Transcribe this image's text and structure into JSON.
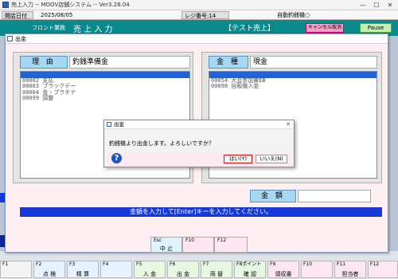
{
  "window": {
    "title": "売上入力 -- MOOV店舗システム -- Ver3.28.04",
    "controls": {
      "minimize": "—",
      "maximize": "☐",
      "close": "✕"
    }
  },
  "infobar": {
    "date_label": "開店日付",
    "date_value": "2025/08/05",
    "register_label": "レジ番号:14",
    "auto_label": "自動釣銭機○"
  },
  "header": {
    "front": "フロント業務",
    "module": "売 上 入 力",
    "test_label": "【テスト売上】",
    "cancel_button": "キャンセル取消",
    "pause_button": "Pause"
  },
  "dialog": {
    "title": "出金",
    "reason": {
      "label": "理 由",
      "value": "釣銭準備金",
      "items": [
        "",
        "00002 支払",
        "00003 ブラックデー",
        "00004 金・プラチナ",
        "00099 調整"
      ]
    },
    "kind": {
      "label": "金 種",
      "value": "現金",
      "items": [
        "",
        "00054 大会参加費EB",
        "00098 自販機入金"
      ]
    },
    "amount": {
      "label": "金 額",
      "value": ""
    },
    "message": "金額を入力して[Enter]キーを入力してください。",
    "keys": [
      {
        "key": "Esc",
        "label": "中 止"
      },
      {
        "key": "F10",
        "label": ""
      },
      {
        "key": "F12",
        "label": ""
      }
    ]
  },
  "confirm": {
    "title": "出金",
    "message": "釣銭機より出金します。よろしいですか？",
    "yes": "はい(Y)",
    "no": "いいえ(N)"
  },
  "fkeys": [
    {
      "key": "F1",
      "label": ""
    },
    {
      "key": "F2",
      "label": "点 検"
    },
    {
      "key": "F3",
      "label": "精 算"
    },
    {
      "key": "F4",
      "label": ""
    },
    {
      "key": "F5",
      "label": "入 金"
    },
    {
      "key": "F6",
      "label": "出 金"
    },
    {
      "key": "F7",
      "label": "両 替"
    },
    {
      "key": "F8ポイント",
      "label": "確 認"
    },
    {
      "key": "F9",
      "label": "領収書"
    },
    {
      "key": "F10",
      "label": ""
    },
    {
      "key": "F11",
      "label": "担当者"
    },
    {
      "key": "F12",
      "label": ""
    }
  ],
  "colors": {
    "accent_blue": "#1538d8",
    "teal": "#0a8a8a",
    "pink": "#fdeff2",
    "label_blue": "#a6d8f2"
  },
  "icons": {
    "question": "question-icon",
    "app": "app-icon"
  }
}
